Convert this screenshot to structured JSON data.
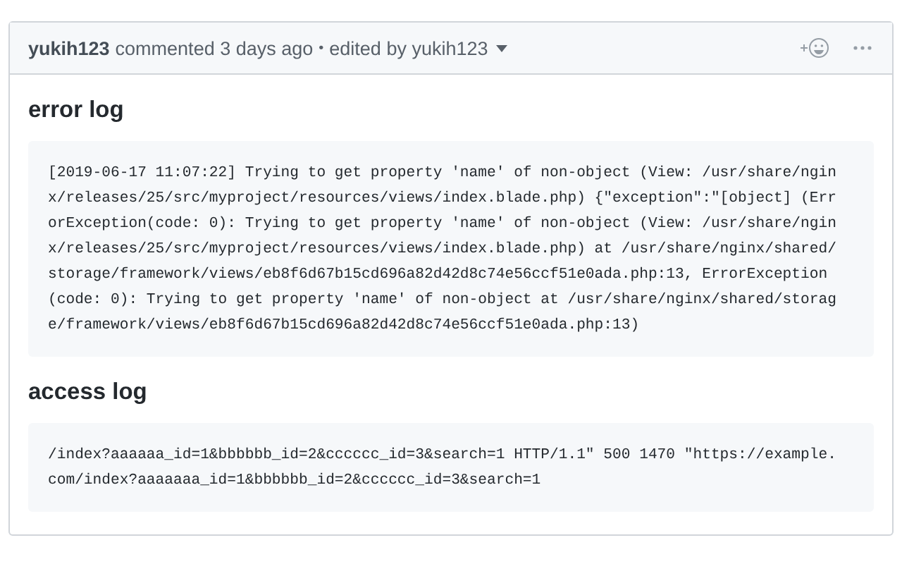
{
  "comment": {
    "author": "yukih123",
    "meta": "commented 3 days ago",
    "separator": "•",
    "edited": "edited by yukih123"
  },
  "sections": [
    {
      "heading": "error log",
      "lines": [
        "[2019-06-17 11:07:22] Trying to get property 'name' of non-object (View: /usr/share/ngin",
        "x/releases/25/src/myproject/resources/views/index.blade.php) {\"exception\":\"[object] (Err",
        "orException(code: 0): Trying to get property 'name' of non-object (View: /usr/share/ngin",
        "x/releases/25/src/myproject/resources/views/index.blade.php) at /usr/share/nginx/shared/",
        "storage/framework/views/eb8f6d67b15cd696a82d42d8c74e56ccf51e0ada.php:13, ErrorException",
        "(code: 0): Trying to get property 'name' of non-object at /usr/share/nginx/shared/storag",
        "e/framework/views/eb8f6d67b15cd696a82d42d8c74e56ccf51e0ada.php:13)"
      ]
    },
    {
      "heading": "access log",
      "lines": [
        "/index?aaaaaa_id=1&bbbbbb_id=2&cccccc_id=3&search=1 HTTP/1.1\" 500 1470 \"https://example.",
        "com/index?aaaaaaa_id=1&bbbbbb_id=2&cccccc_id=3&search=1"
      ]
    }
  ]
}
